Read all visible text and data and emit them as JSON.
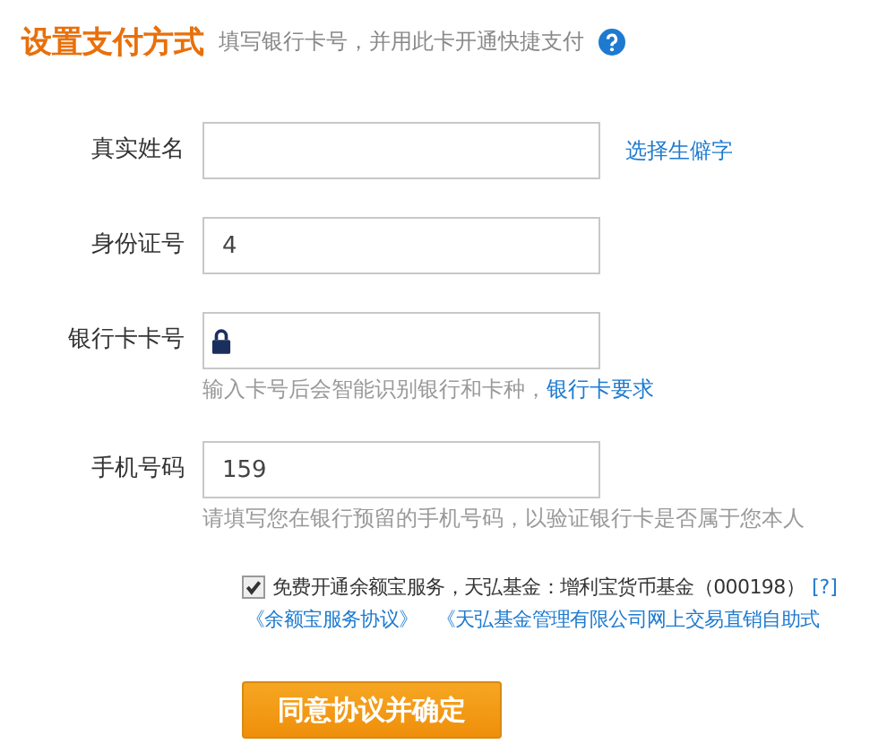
{
  "header": {
    "title": "设置支付方式",
    "subtitle": "填写银行卡号，并用此卡开通快捷支付"
  },
  "fields": [
    {
      "kind": "text",
      "label": "真实姓名",
      "link": "选择生僻字"
    },
    {
      "kind": "text",
      "label": "身份证号",
      "value": "4"
    },
    {
      "kind": "card",
      "label": "银行卡卡号",
      "hint": "输入卡号后会智能识别银行和卡种，",
      "hint_link": "银行卡要求"
    },
    {
      "kind": "text",
      "label": "手机号码",
      "value": "159",
      "hint": "请填写您在银行预留的手机号码，以验证银行卡是否属于您本人"
    }
  ],
  "agreement": {
    "checked": true,
    "text": "免费开通余额宝服务，天弘基金：增利宝货币基金（000198）",
    "help_link": "[?]",
    "links": [
      "《余额宝服务协议》",
      "《天弘基金管理有限公司网上交易直销自助式"
    ]
  },
  "submit": "同意协议并确定"
}
